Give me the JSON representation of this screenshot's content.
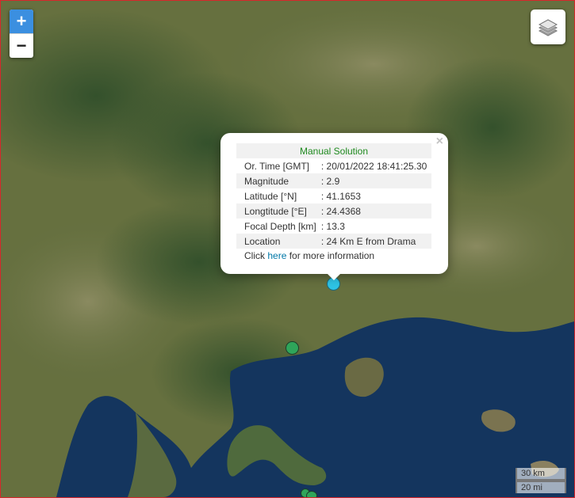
{
  "map": {
    "zoom_in_label": "+",
    "zoom_out_label": "−",
    "layers_icon": "layers-icon"
  },
  "popup": {
    "title": "Manual Solution",
    "close_label": "×",
    "rows": [
      {
        "label": "Or. Time [GMT]",
        "value": ": 20/01/2022 18:41:25.30"
      },
      {
        "label": "Magnitude",
        "value": ": 2.9"
      },
      {
        "label": "Latitude [°N]",
        "value": ": 41.1653"
      },
      {
        "label": "Longtitude [°E]",
        "value": ": 24.4368"
      },
      {
        "label": "Focal Depth [km]",
        "value": ": 13.3"
      },
      {
        "label": "Location",
        "value": ": 24 Km E from Drama"
      }
    ],
    "more_prefix": "Click ",
    "more_link": "here",
    "more_suffix": " for more information"
  },
  "scale": {
    "km_label": "30 km",
    "mi_label": "20 mi"
  },
  "colors": {
    "selected_marker": "#2ec4e6",
    "event_marker": "#2fa55a",
    "title_green": "#1f8a1f",
    "link_blue": "#0078a8"
  }
}
